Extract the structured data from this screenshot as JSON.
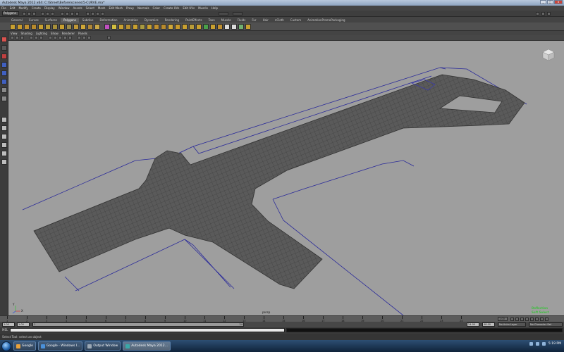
{
  "window": {
    "title": "Autodesk Maya 2012 x64: C:\\Street\\Before\\scenes\\5-CURVE.ma*",
    "buttons": [
      "_",
      "□",
      "x"
    ]
  },
  "menubar": [
    "File",
    "Edit",
    "Modify",
    "Create",
    "Display",
    "Window",
    "Assets",
    "Select",
    "Mesh",
    "Edit Mesh",
    "Proxy",
    "Normals",
    "Color",
    "Create UVs",
    "Edit UVs",
    "Muscle",
    "Help"
  ],
  "statusline": {
    "mode": "Polygons"
  },
  "shelf_tabs": [
    "General",
    "Curves",
    "Surfaces",
    "Polygons",
    "Subdivs",
    "Deformation",
    "Animation",
    "Dynamics",
    "Rendering",
    "PaintEffects",
    "Toon",
    "Muscle",
    "Fluids",
    "Fur",
    "Hair",
    "nCloth",
    "Custom",
    "AnimationPromoPackaging"
  ],
  "active_shelf_tab": "Polygons",
  "panel_menu": [
    "View",
    "Shading",
    "Lighting",
    "Show",
    "Renderer",
    "Panels"
  ],
  "viewport": {
    "camera_label": "persp",
    "hud": [
      "Deflection",
      "Soft Select"
    ],
    "hud_color": "#3fbf3f",
    "axis_labels": [
      "Y",
      "X"
    ]
  },
  "timeslider": {
    "ticks": [
      "1",
      "2",
      "3",
      "4",
      "5",
      "6",
      "7",
      "8",
      "9",
      "10",
      "11",
      "12",
      "13",
      "14",
      "15",
      "16",
      "17",
      "18",
      "19",
      "20",
      "21",
      "22",
      "23",
      "24"
    ],
    "current_frame": "1.00"
  },
  "range": {
    "start": "1.00",
    "start2": "1.00",
    "marker_left": "1",
    "marker_right": "24",
    "end": "24.00",
    "end2": "48.00",
    "anim_layer": "No Anim Layer",
    "char_set": "No Character Set"
  },
  "command": {
    "label": "MEL"
  },
  "help_text": "Select Tool: select an object",
  "taskbar": {
    "tasks": [
      {
        "label": "Google",
        "color": "#e9a23b"
      },
      {
        "label": "Google - Windows I...",
        "color": "#4a90d9"
      },
      {
        "label": "Output Window",
        "color": "#9aa7b4"
      },
      {
        "label": "Autodesk Maya 2012...",
        "color": "#3aa8a8"
      }
    ],
    "clock": "5:19 PM"
  },
  "colors": {
    "viewport_bg": "#9e9e9e",
    "mesh": "#4a4a4a",
    "curves": "#2a2a9a"
  }
}
